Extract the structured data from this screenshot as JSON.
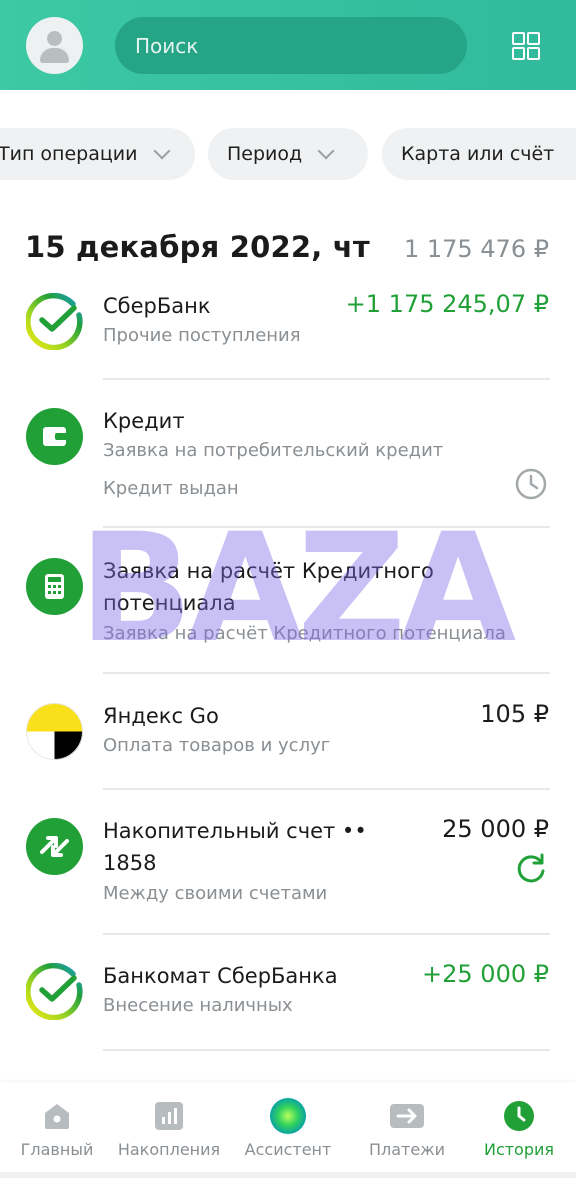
{
  "header": {
    "search_placeholder": "Поиск"
  },
  "filters": [
    {
      "label": "Тип операции"
    },
    {
      "label": "Период"
    },
    {
      "label": "Карта или счёт"
    }
  ],
  "day": {
    "date": "15 декабря 2022, чт",
    "total": "1 175 476 ₽"
  },
  "transactions": [
    {
      "name": "СберБанк",
      "sub": "Прочие поступления",
      "amount": "+1 175 245,07 ₽",
      "icon": "sber-logo-icon"
    },
    {
      "name": "Кредит",
      "sub": "Заявка на потребительский кредит",
      "status": "Кредит выдан",
      "icon": "wallet-icon",
      "status_icon": "clock-icon"
    },
    {
      "name_line1": "Заявка на расчёт Кредитного",
      "name_line2": "потенциала",
      "sub": "Заявка на расчёт Кредитного потенциала",
      "icon": "calculator-icon"
    },
    {
      "name": "Яндекс Go",
      "sub": "Оплата товаров и услуг",
      "amount": "105 ₽",
      "icon": "yandex-go-logo-icon"
    },
    {
      "name_line1": "Накопительный счет ••",
      "name_line2": "1858",
      "sub": "Между своими счетами",
      "amount": "25 000 ₽",
      "icon": "transfer-arrows-icon",
      "status_icon": "refresh-icon"
    },
    {
      "name": "Банкомат СберБанка",
      "sub": "Внесение наличных",
      "amount": "+25 000 ₽",
      "icon": "sber-logo-icon"
    }
  ],
  "watermark": "BAZA",
  "nav": [
    {
      "label": "Главный",
      "icon": "home-icon"
    },
    {
      "label": "Накопления",
      "icon": "chart-icon"
    },
    {
      "label": "Ассистент",
      "icon": "assistant-orb-icon"
    },
    {
      "label": "Платежи",
      "icon": "payments-arrow-icon"
    },
    {
      "label": "История",
      "icon": "history-clock-icon",
      "active": true
    }
  ],
  "colors": {
    "header": "#31b99c",
    "accent_green": "#21a038",
    "muted_text": "#8a8f93"
  }
}
